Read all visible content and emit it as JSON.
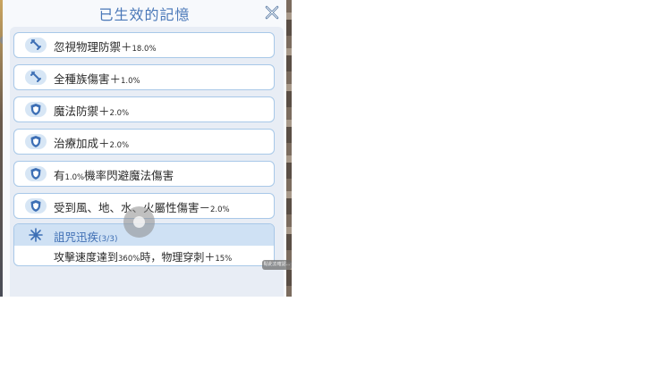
{
  "title": "已生效的記憶",
  "close_icon": "close-x-icon",
  "colors": {
    "title": "#4a78b8",
    "row_border": "#a8c8e8",
    "set_header": "#cfe1f4",
    "icon_bg": "#d7e6f5"
  },
  "effects": [
    {
      "icon": "sword-icon",
      "label": "忽視物理防禦＋",
      "value": "18.0%"
    },
    {
      "icon": "sword-icon",
      "label": "全種族傷害＋",
      "value": "1.0%"
    },
    {
      "icon": "shield-icon",
      "label": "魔法防禦＋",
      "value": "2.0%"
    },
    {
      "icon": "shield-icon",
      "label": "治療加成＋",
      "value": "2.0%"
    },
    {
      "icon": "shield-icon",
      "label_pre": "有",
      "value": "1.0%",
      "label_post": "機率閃避魔法傷害"
    },
    {
      "icon": "shield-icon",
      "label": "受到風、地、水、火屬性傷害－",
      "value": "2.0%"
    }
  ],
  "set_bonus": {
    "icon": "snowflake-icon",
    "name": "詛咒迅疾",
    "count": "(3/3)",
    "effect_a": "攻擊速度達到",
    "effect_v1": "360%",
    "effect_b": "時，物理穿刺＋",
    "effect_v2": "15%"
  },
  "overlay_hint": "點此去確認..."
}
